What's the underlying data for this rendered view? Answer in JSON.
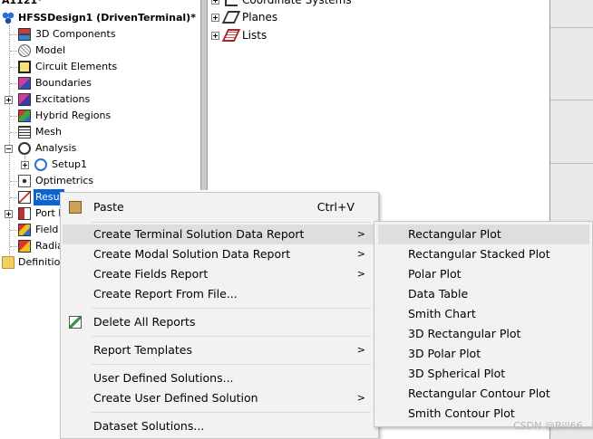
{
  "tree": {
    "top_label": "A1121*",
    "design_label": "HFSSDesign1 (DrivenTerminal)*",
    "items": [
      {
        "label": "3D Components",
        "icon": "3d-components-icon"
      },
      {
        "label": "Model",
        "icon": "model-icon"
      },
      {
        "label": "Circuit Elements",
        "icon": "circuit-elements-icon"
      },
      {
        "label": "Boundaries",
        "icon": "boundaries-icon"
      },
      {
        "label": "Excitations",
        "icon": "excitations-icon"
      },
      {
        "label": "Hybrid Regions",
        "icon": "hybrid-regions-icon"
      },
      {
        "label": "Mesh",
        "icon": "mesh-icon"
      },
      {
        "label": "Analysis",
        "icon": "analysis-icon"
      },
      {
        "label": "Setup1",
        "icon": "setup-icon"
      },
      {
        "label": "Optimetrics",
        "icon": "optimetrics-icon"
      },
      {
        "label": "Resul",
        "icon": "results-icon"
      },
      {
        "label": "Port F",
        "icon": "port-field-icon"
      },
      {
        "label": "Field",
        "icon": "field-overlays-icon"
      },
      {
        "label": "Radia",
        "icon": "radiation-icon"
      },
      {
        "label": "Definitio",
        "icon": "folder-icon"
      }
    ]
  },
  "right_tree": {
    "items": [
      {
        "label": "Coordinate Systems",
        "icon": "coordinate-systems-icon"
      },
      {
        "label": "Planes",
        "icon": "planes-icon"
      },
      {
        "label": "Lists",
        "icon": "lists-icon"
      }
    ]
  },
  "context_menu": {
    "paste": {
      "label": "Paste",
      "shortcut": "Ctrl+V",
      "icon": "paste-icon"
    },
    "create_terminal": "Create Terminal Solution Data Report",
    "create_modal": "Create Modal Solution Data Report",
    "create_fields": "Create Fields Report",
    "create_from_file": "Create Report From File...",
    "delete_all": {
      "label": "Delete All Reports",
      "icon": "delete-reports-icon"
    },
    "report_templates": "Report Templates",
    "user_defined": "User Defined Solutions...",
    "create_user_defined": "Create User Defined Solution",
    "dataset_solutions": "Dataset Solutions...",
    "submenu_arrow": ">"
  },
  "submenu": {
    "items": [
      "Rectangular Plot",
      "Rectangular Stacked Plot",
      "Polar Plot",
      "Data Table",
      "Smith Chart",
      "3D Rectangular Plot",
      "3D Polar Plot",
      "3D Spherical Plot",
      "Rectangular Contour Plot",
      "Smith Contour Plot"
    ]
  },
  "watermark": "CSDN @Bill66",
  "colors": {
    "menu_bg": "#f2f2f2",
    "highlight": "#dedede",
    "selection": "#0a64d4"
  }
}
